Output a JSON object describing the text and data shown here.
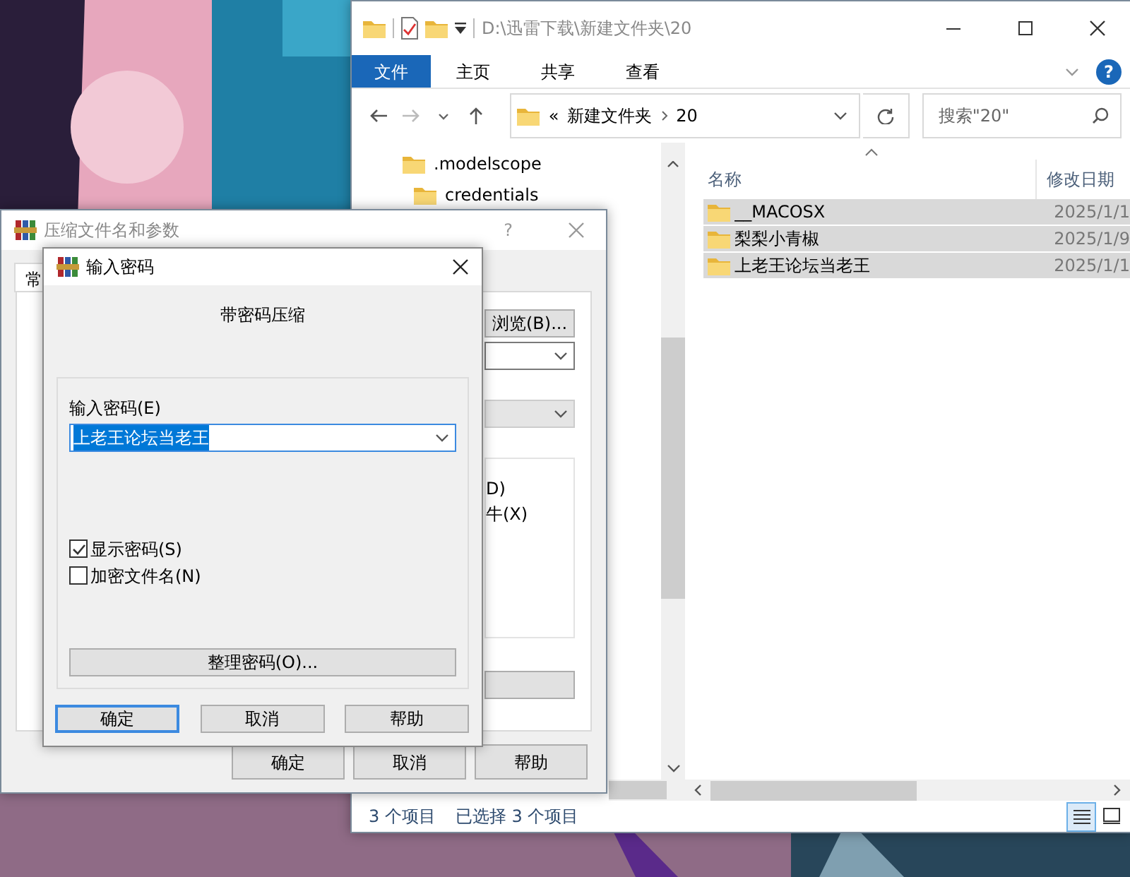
{
  "explorer": {
    "title": "D:\\迅雷下载\\新建文件夹\\20",
    "help_glyph": "?",
    "ribbon_tabs": [
      {
        "label": "文件",
        "kind": "file"
      },
      {
        "label": "主页",
        "kind": "tab"
      },
      {
        "label": "共享",
        "kind": "tab"
      },
      {
        "label": "查看",
        "kind": "tab"
      }
    ],
    "address": {
      "overflow": "«",
      "crumbs": [
        "新建文件夹",
        "20"
      ]
    },
    "search": {
      "placeholder": "搜索\"20\""
    },
    "nav_items": [
      {
        "label": ".modelscope",
        "children": [
          {
            "label": "credentials"
          }
        ]
      }
    ],
    "columns": [
      "名称",
      "修改日期"
    ],
    "rows": [
      {
        "name": "__MACOSX",
        "date": "2025/1/1",
        "selected": true
      },
      {
        "name": "梨梨小青椒",
        "date": "2025/1/9",
        "selected": true
      },
      {
        "name": "上老王论坛当老王",
        "date": "2025/1/1",
        "selected": true
      }
    ],
    "status_bar": {
      "count": "3 个项目",
      "selection": "已选择 3 个项目"
    },
    "view_modes": [
      {
        "kind": "details",
        "selected": true
      },
      {
        "kind": "thumbnails",
        "selected": false
      }
    ]
  },
  "archive_dialog": {
    "title": "压缩文件名和参数",
    "help_glyph": "?",
    "tab": "常",
    "browse_button": "浏览(B)...",
    "options": [
      "D)",
      "牛(X)"
    ],
    "buttons": [
      "确定",
      "取消",
      "帮助"
    ]
  },
  "password_dialog": {
    "title": "输入密码",
    "heading": "带密码压缩",
    "password_label": "输入密码(E)",
    "password_value": "上老王论坛当老王",
    "checkboxes": [
      {
        "label": "显示密码(S)",
        "checked": true
      },
      {
        "label": "加密文件名(N)",
        "checked": false
      }
    ],
    "organize_button": "整理密码(O)...",
    "buttons": [
      {
        "label": "确定",
        "default": true
      },
      {
        "label": "取消",
        "default": false
      },
      {
        "label": "帮助",
        "default": false
      }
    ]
  }
}
